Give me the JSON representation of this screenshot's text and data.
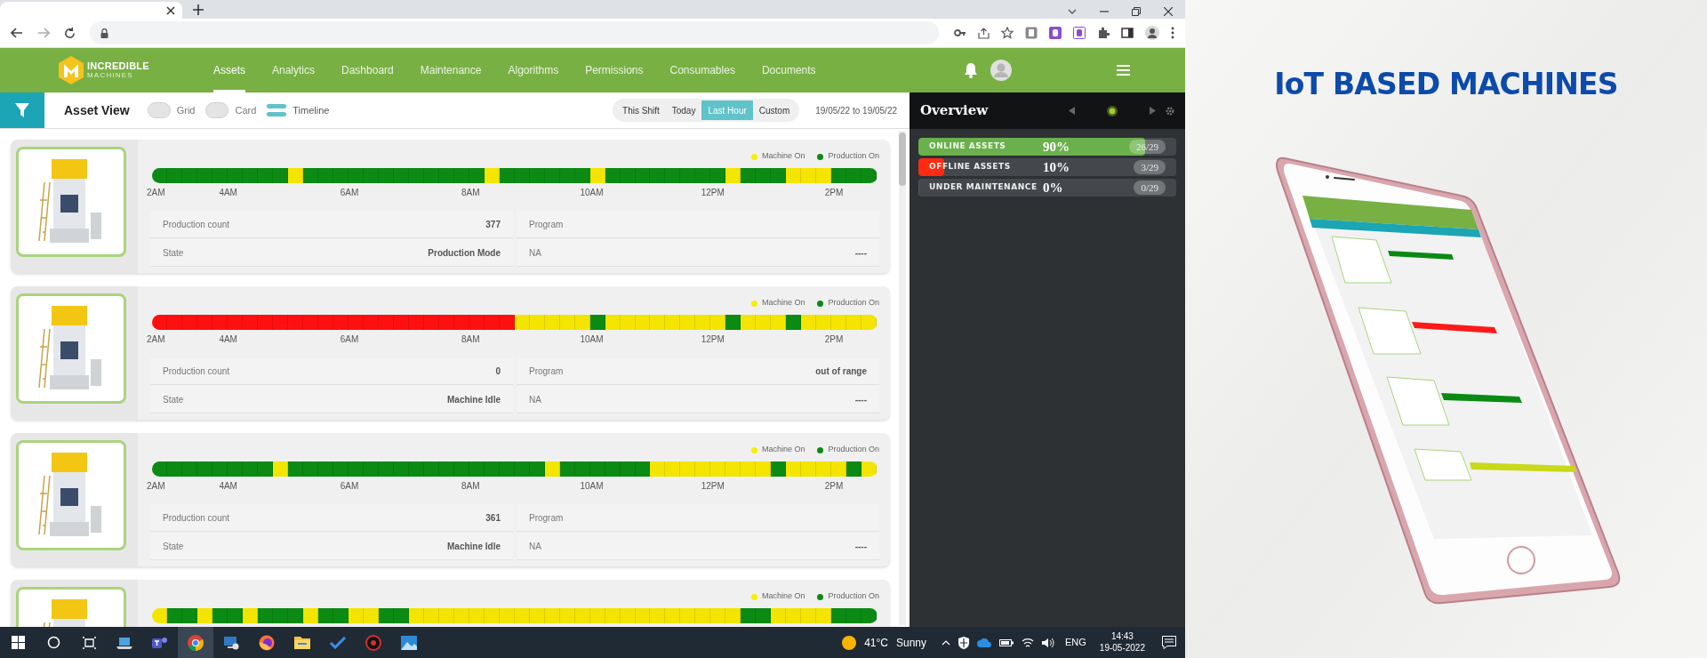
{
  "header": {
    "logo": {
      "line1": "INCREDIBLE",
      "line2": "MACHINES"
    },
    "nav": [
      {
        "label": "Assets",
        "selected": true
      },
      {
        "label": "Analytics",
        "selected": false
      },
      {
        "label": "Dashboard",
        "selected": false
      },
      {
        "label": "Maintenance",
        "selected": false
      },
      {
        "label": "Algorithms",
        "selected": false
      },
      {
        "label": "Permissions",
        "selected": false
      },
      {
        "label": "Consumables",
        "selected": false
      },
      {
        "label": "Documents",
        "selected": false
      }
    ]
  },
  "toolbar": {
    "title": "Asset View",
    "views": [
      {
        "label": "Grid",
        "selected": false
      },
      {
        "label": "Card",
        "selected": false
      },
      {
        "label": "Timeline",
        "selected": true
      }
    ],
    "ranges": [
      {
        "label": "This Shift",
        "selected": false
      },
      {
        "label": "Today",
        "selected": false
      },
      {
        "label": "Last Hour",
        "selected": true
      },
      {
        "label": "Custom",
        "selected": false
      }
    ],
    "date_range": "19/05/22 to 19/05/22"
  },
  "assets": [
    {
      "legend": [
        "Machine On",
        "Production On"
      ],
      "timeline": [
        {
          "kind": "production"
        },
        {
          "kind": "production"
        },
        {
          "kind": "production"
        },
        {
          "kind": "production"
        },
        {
          "kind": "production"
        },
        {
          "kind": "production"
        },
        {
          "kind": "production"
        },
        {
          "kind": "production"
        },
        {
          "kind": "production"
        },
        {
          "kind": "machine"
        },
        {
          "kind": "production"
        },
        {
          "kind": "production"
        },
        {
          "kind": "production"
        },
        {
          "kind": "production"
        },
        {
          "kind": "production"
        },
        {
          "kind": "production"
        },
        {
          "kind": "production"
        },
        {
          "kind": "production"
        },
        {
          "kind": "production"
        },
        {
          "kind": "production"
        },
        {
          "kind": "production"
        },
        {
          "kind": "production"
        },
        {
          "kind": "machine"
        },
        {
          "kind": "production"
        },
        {
          "kind": "production"
        },
        {
          "kind": "production"
        },
        {
          "kind": "production"
        },
        {
          "kind": "production"
        },
        {
          "kind": "production"
        },
        {
          "kind": "machine"
        },
        {
          "kind": "production"
        },
        {
          "kind": "production"
        },
        {
          "kind": "production"
        },
        {
          "kind": "production"
        },
        {
          "kind": "production"
        },
        {
          "kind": "production"
        },
        {
          "kind": "production"
        },
        {
          "kind": "production"
        },
        {
          "kind": "machine"
        },
        {
          "kind": "production"
        },
        {
          "kind": "production"
        },
        {
          "kind": "production"
        },
        {
          "kind": "machine"
        },
        {
          "kind": "machine"
        },
        {
          "kind": "machine"
        },
        {
          "kind": "production"
        },
        {
          "kind": "production"
        },
        {
          "kind": "production"
        }
      ],
      "ticks": [
        "2AM",
        "4AM",
        "6AM",
        "8AM",
        "10AM",
        "12PM",
        "2PM"
      ],
      "info": [
        {
          "label": "Production count",
          "value": "377"
        },
        {
          "label": "Program"
        },
        {
          "label": "State",
          "value": "Production Mode"
        },
        {
          "label": "NA",
          "value": "----"
        }
      ]
    },
    {
      "legend": [
        "Machine On",
        "Production On"
      ],
      "timeline": [
        {
          "kind": "offline"
        },
        {
          "kind": "offline"
        },
        {
          "kind": "offline"
        },
        {
          "kind": "offline"
        },
        {
          "kind": "offline"
        },
        {
          "kind": "offline"
        },
        {
          "kind": "offline"
        },
        {
          "kind": "offline"
        },
        {
          "kind": "offline"
        },
        {
          "kind": "offline"
        },
        {
          "kind": "offline"
        },
        {
          "kind": "offline"
        },
        {
          "kind": "offline"
        },
        {
          "kind": "offline"
        },
        {
          "kind": "offline"
        },
        {
          "kind": "offline"
        },
        {
          "kind": "offline"
        },
        {
          "kind": "offline"
        },
        {
          "kind": "offline"
        },
        {
          "kind": "offline"
        },
        {
          "kind": "offline"
        },
        {
          "kind": "offline"
        },
        {
          "kind": "offline"
        },
        {
          "kind": "offline"
        },
        {
          "kind": "machine"
        },
        {
          "kind": "machine"
        },
        {
          "kind": "machine"
        },
        {
          "kind": "machine"
        },
        {
          "kind": "machine"
        },
        {
          "kind": "production"
        },
        {
          "kind": "machine"
        },
        {
          "kind": "machine"
        },
        {
          "kind": "machine"
        },
        {
          "kind": "machine"
        },
        {
          "kind": "machine"
        },
        {
          "kind": "machine"
        },
        {
          "kind": "machine"
        },
        {
          "kind": "machine"
        },
        {
          "kind": "production"
        },
        {
          "kind": "machine"
        },
        {
          "kind": "machine"
        },
        {
          "kind": "machine"
        },
        {
          "kind": "production"
        },
        {
          "kind": "machine"
        },
        {
          "kind": "machine"
        },
        {
          "kind": "machine"
        },
        {
          "kind": "machine"
        },
        {
          "kind": "machine"
        }
      ],
      "ticks": [
        "2AM",
        "4AM",
        "6AM",
        "8AM",
        "10AM",
        "12PM",
        "2PM"
      ],
      "info": [
        {
          "label": "Production count",
          "value": "0"
        },
        {
          "label": "Program",
          "value": "out of range"
        },
        {
          "label": "State",
          "value": "Machine Idle"
        },
        {
          "label": "NA",
          "value": "----"
        }
      ]
    },
    {
      "legend": [
        "Machine On",
        "Production On"
      ],
      "timeline": [
        {
          "kind": "production"
        },
        {
          "kind": "production"
        },
        {
          "kind": "production"
        },
        {
          "kind": "production"
        },
        {
          "kind": "production"
        },
        {
          "kind": "production"
        },
        {
          "kind": "production"
        },
        {
          "kind": "production"
        },
        {
          "kind": "machine"
        },
        {
          "kind": "production"
        },
        {
          "kind": "production"
        },
        {
          "kind": "production"
        },
        {
          "kind": "production"
        },
        {
          "kind": "production"
        },
        {
          "kind": "production"
        },
        {
          "kind": "production"
        },
        {
          "kind": "production"
        },
        {
          "kind": "production"
        },
        {
          "kind": "production"
        },
        {
          "kind": "production"
        },
        {
          "kind": "production"
        },
        {
          "kind": "production"
        },
        {
          "kind": "production"
        },
        {
          "kind": "production"
        },
        {
          "kind": "production"
        },
        {
          "kind": "production"
        },
        {
          "kind": "machine"
        },
        {
          "kind": "production"
        },
        {
          "kind": "production"
        },
        {
          "kind": "production"
        },
        {
          "kind": "production"
        },
        {
          "kind": "production"
        },
        {
          "kind": "production"
        },
        {
          "kind": "machine"
        },
        {
          "kind": "machine"
        },
        {
          "kind": "machine"
        },
        {
          "kind": "machine"
        },
        {
          "kind": "machine"
        },
        {
          "kind": "machine"
        },
        {
          "kind": "machine"
        },
        {
          "kind": "machine"
        },
        {
          "kind": "production"
        },
        {
          "kind": "machine"
        },
        {
          "kind": "machine"
        },
        {
          "kind": "machine"
        },
        {
          "kind": "machine"
        },
        {
          "kind": "production"
        },
        {
          "kind": "machine"
        }
      ],
      "ticks": [
        "2AM",
        "4AM",
        "6AM",
        "8AM",
        "10AM",
        "12PM",
        "2PM"
      ],
      "info": [
        {
          "label": "Production count",
          "value": "361"
        },
        {
          "label": "Program"
        },
        {
          "label": "State",
          "value": "Machine Idle"
        },
        {
          "label": "NA",
          "value": "----"
        }
      ]
    },
    {
      "legend": [
        "Machine On",
        "Production On"
      ],
      "timeline": [
        {
          "kind": "machine"
        },
        {
          "kind": "production"
        },
        {
          "kind": "production"
        },
        {
          "kind": "machine"
        },
        {
          "kind": "production"
        },
        {
          "kind": "production"
        },
        {
          "kind": "machine"
        },
        {
          "kind": "production"
        },
        {
          "kind": "production"
        },
        {
          "kind": "production"
        },
        {
          "kind": "machine"
        },
        {
          "kind": "production"
        },
        {
          "kind": "production"
        },
        {
          "kind": "machine"
        },
        {
          "kind": "machine"
        },
        {
          "kind": "production"
        },
        {
          "kind": "production"
        },
        {
          "kind": "machine"
        },
        {
          "kind": "machine"
        },
        {
          "kind": "machine"
        },
        {
          "kind": "machine"
        },
        {
          "kind": "machine"
        },
        {
          "kind": "machine"
        },
        {
          "kind": "machine"
        },
        {
          "kind": "machine"
        },
        {
          "kind": "machine"
        },
        {
          "kind": "machine"
        },
        {
          "kind": "machine"
        },
        {
          "kind": "machine"
        },
        {
          "kind": "machine"
        },
        {
          "kind": "machine"
        },
        {
          "kind": "machine"
        },
        {
          "kind": "machine"
        },
        {
          "kind": "machine"
        },
        {
          "kind": "machine"
        },
        {
          "kind": "machine"
        },
        {
          "kind": "machine"
        },
        {
          "kind": "machine"
        },
        {
          "kind": "machine"
        },
        {
          "kind": "production"
        },
        {
          "kind": "production"
        },
        {
          "kind": "machine"
        },
        {
          "kind": "machine"
        },
        {
          "kind": "machine"
        },
        {
          "kind": "machine"
        },
        {
          "kind": "production"
        },
        {
          "kind": "production"
        },
        {
          "kind": "production"
        }
      ]
    }
  ],
  "overview": {
    "title": "Overview",
    "items": [
      {
        "label": "ONLINE ASSETS",
        "percent": "90%",
        "count": "26/29",
        "level": 0.88,
        "color": "#6ab04c"
      },
      {
        "label": "OFFLINE ASSETS",
        "percent": "10%",
        "count": "3/29",
        "level": 0.1,
        "color": "#ff2a12"
      },
      {
        "label": "UNDER MAINTENANCE",
        "percent": "0%",
        "count": "0/29",
        "level": 0
      }
    ]
  },
  "taskbar": {
    "temperature": "41°C",
    "weather": "Sunny",
    "language": "ENG",
    "time": "14:43",
    "date": "19-05-2022"
  },
  "promo": {
    "title": "IoT BASED MACHINES"
  }
}
